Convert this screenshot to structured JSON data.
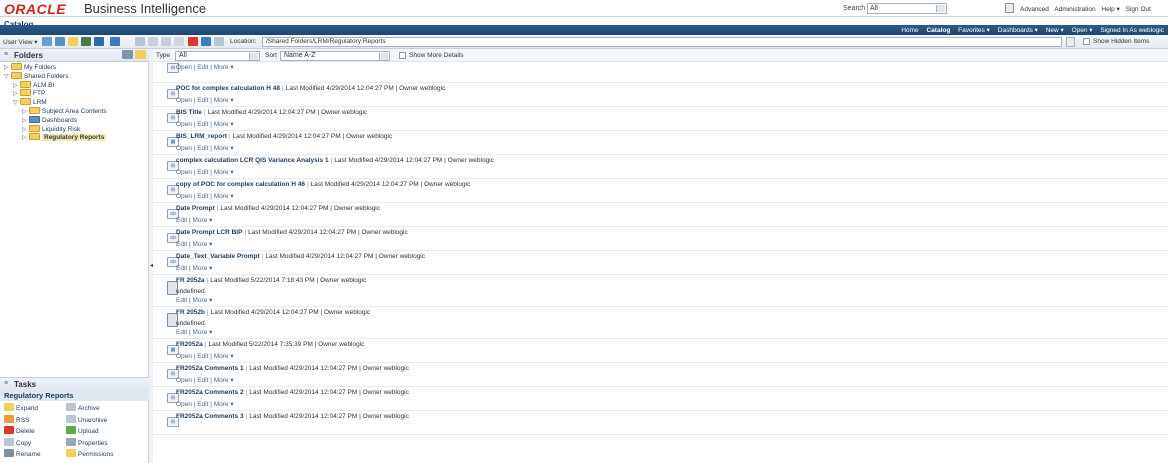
{
  "brand": {
    "logo": "ORACLE",
    "product": "Business Intelligence"
  },
  "search": {
    "label": "Search",
    "scope": "All"
  },
  "global_links": [
    "Advanced",
    "Administration",
    "Help ▾",
    "Sign Out"
  ],
  "catalog_title": "Catalog",
  "nav_links": [
    "Home",
    "Catalog",
    "Favorites ▾",
    "Dashboards ▾",
    "New ▾",
    "Open ▾",
    "Signed In As  weblogic"
  ],
  "toolbar": {
    "user_view": "User View ▾",
    "location_label": "Location:",
    "location_value": "/Shared Folders/LRM/Regulatory Reports",
    "show_hidden_label": "Show Hidden Items"
  },
  "folders": {
    "title": "Folders",
    "tree": [
      {
        "label": "My Folders",
        "twisty": "▷",
        "depth": 0,
        "dash": false
      },
      {
        "label": "Shared Folders",
        "twisty": "▽",
        "depth": 0,
        "dash": false
      },
      {
        "label": "ALM BI",
        "twisty": "▷",
        "depth": 1,
        "dash": false
      },
      {
        "label": "FTP",
        "twisty": "▷",
        "depth": 1,
        "dash": false
      },
      {
        "label": "LRM",
        "twisty": "▽",
        "depth": 1,
        "dash": false
      },
      {
        "label": "Subject Area Contents",
        "twisty": "▷",
        "depth": 2,
        "dash": false
      },
      {
        "label": "Dashboards",
        "twisty": "▷",
        "depth": 2,
        "dash": true
      },
      {
        "label": "Liquidity Risk",
        "twisty": "▷",
        "depth": 2,
        "dash": false
      },
      {
        "label": "Regulatory Reports",
        "twisty": "▷",
        "depth": 2,
        "dash": false,
        "selected": true
      }
    ]
  },
  "tasks": {
    "title": "Tasks",
    "subtitle": "Regulatory Reports",
    "left": [
      "Expand",
      "RSS",
      "Delete",
      "Copy",
      "Rename"
    ],
    "right": [
      "Archive",
      "Unarchive",
      "Upload",
      "Properties",
      "Permissions"
    ],
    "left_colors": [
      "#f2cf5b",
      "#f29a3a",
      "#d93a2c",
      "#b9c6d4",
      "#7e8fa2"
    ],
    "right_colors": [
      "#b9c6d4",
      "#b9c6d4",
      "#62a64a",
      "#9aa8b6",
      "#f2cf5b"
    ]
  },
  "filter": {
    "type_label": "Type",
    "type_value": "All",
    "sort_label": "Sort",
    "sort_value": "Name A-Z",
    "details_label": "Show More Details"
  },
  "items": [
    {
      "name": "",
      "meta": "",
      "sub": "",
      "actions": "Open | Edit | More ▾",
      "icon": "analysis",
      "partial": true
    },
    {
      "name": "POC for complex calculation H 48",
      "meta": "Last Modified 4/29/2014 12:04:27 PM  |  Owner weblogic",
      "sub": "",
      "actions": "Open | Edit | More ▾",
      "icon": "analysis"
    },
    {
      "name": "BIS Title",
      "meta": "Last Modified 4/29/2014 12:04:27 PM  |  Owner weblogic",
      "sub": "",
      "actions": "Open | Edit | More ▾",
      "icon": "analysis"
    },
    {
      "name": "BIS_LRM_report",
      "meta": "Last Modified 4/29/2014 12:04:27 PM  |  Owner weblogic",
      "sub": "",
      "actions": "Open | Edit | More ▾",
      "icon": "report"
    },
    {
      "name": "complex calculation LCR QIS Variance Analysis 1",
      "meta": "Last Modified 4/29/2014 12:04:27 PM  |  Owner weblogic",
      "sub": "",
      "actions": "Open | Edit | More ▾",
      "icon": "analysis"
    },
    {
      "name": "copy of POC for complex calculation H 46",
      "meta": "Last Modified 4/29/2014 12:04:27 PM  |  Owner weblogic",
      "sub": "",
      "actions": "Open | Edit | More ▾",
      "icon": "analysis"
    },
    {
      "name": "Date Prompt",
      "meta": "Last Modified 4/29/2014 12:04:27 PM  |  Owner weblogic",
      "sub": "",
      "actions": "Edit | More ▾",
      "icon": "prompt"
    },
    {
      "name": "Date Prompt LCR BIP",
      "meta": "Last Modified 4/29/2014 12:04:27 PM  |  Owner weblogic",
      "sub": "",
      "actions": "Edit | More ▾",
      "icon": "prompt"
    },
    {
      "name": "Date_Text_Variable Prompt",
      "meta": "Last Modified 4/29/2014 12:04:27 PM  |  Owner weblogic",
      "sub": "",
      "actions": "Edit | More ▾",
      "icon": "prompt"
    },
    {
      "name": "FR 2052a",
      "meta": "Last Modified 5/22/2014 7:18:43 PM  |  Owner weblogic",
      "sub": "undefined",
      "actions": "Edit | More ▾",
      "icon": "doc"
    },
    {
      "name": "FR 2052b",
      "meta": "Last Modified 4/29/2014 12:04:27 PM  |  Owner weblogic",
      "sub": "undefined",
      "actions": "Edit | More ▾",
      "icon": "doc"
    },
    {
      "name": "FR2052a",
      "meta": "Last Modified 5/22/2014 7:35:39 PM  |  Owner weblogic",
      "sub": "",
      "actions": "Open | Edit | More ▾",
      "icon": "report"
    },
    {
      "name": "FR2052a Comments 1",
      "meta": "Last Modified 4/29/2014 12:04:27 PM  |  Owner weblogic",
      "sub": "",
      "actions": "Open | Edit | More ▾",
      "icon": "analysis"
    },
    {
      "name": "FR2052a Comments 2",
      "meta": "Last Modified 4/29/2014 12:04:27 PM  |  Owner weblogic",
      "sub": "",
      "actions": "Open | Edit | More ▾",
      "icon": "analysis"
    },
    {
      "name": "FR2052a Comments 3",
      "meta": "Last Modified 4/29/2014 12:04:27 PM  |  Owner weblogic",
      "sub": "",
      "actions": "",
      "icon": "analysis"
    }
  ]
}
